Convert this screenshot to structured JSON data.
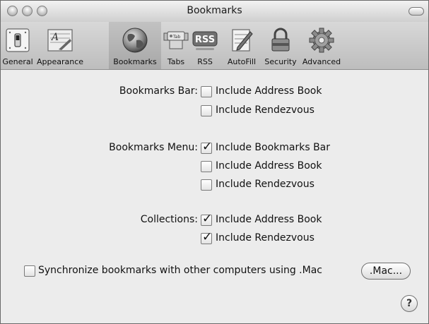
{
  "window": {
    "title": "Bookmarks"
  },
  "toolbar": {
    "items": [
      {
        "label": "General",
        "icon": "switch-icon"
      },
      {
        "label": "Appearance",
        "icon": "font-sample-icon"
      },
      {
        "label": "Bookmarks",
        "icon": "globe-icon",
        "selected": true
      },
      {
        "label": "Tabs",
        "icon": "tab-icon"
      },
      {
        "label": "RSS",
        "icon": "rss-icon"
      },
      {
        "label": "AutoFill",
        "icon": "pen-form-icon"
      },
      {
        "label": "Security",
        "icon": "lock-icon"
      },
      {
        "label": "Advanced",
        "icon": "gear-icon"
      }
    ]
  },
  "bookmarks_bar": {
    "label": "Bookmarks Bar:",
    "options": [
      {
        "label": "Include Address Book",
        "checked": false
      },
      {
        "label": "Include Rendezvous",
        "checked": false
      }
    ]
  },
  "bookmarks_menu": {
    "label": "Bookmarks Menu:",
    "options": [
      {
        "label": "Include Bookmarks Bar",
        "checked": true
      },
      {
        "label": "Include Address Book",
        "checked": false
      },
      {
        "label": "Include Rendezvous",
        "checked": false
      }
    ]
  },
  "collections": {
    "label": "Collections:",
    "options": [
      {
        "label": "Include Address Book",
        "checked": true
      },
      {
        "label": "Include Rendezvous",
        "checked": true
      }
    ]
  },
  "sync": {
    "label": "Synchronize bookmarks with other computers using .Mac",
    "checked": false,
    "button_label": ".Mac..."
  },
  "help": {
    "label": "?"
  }
}
